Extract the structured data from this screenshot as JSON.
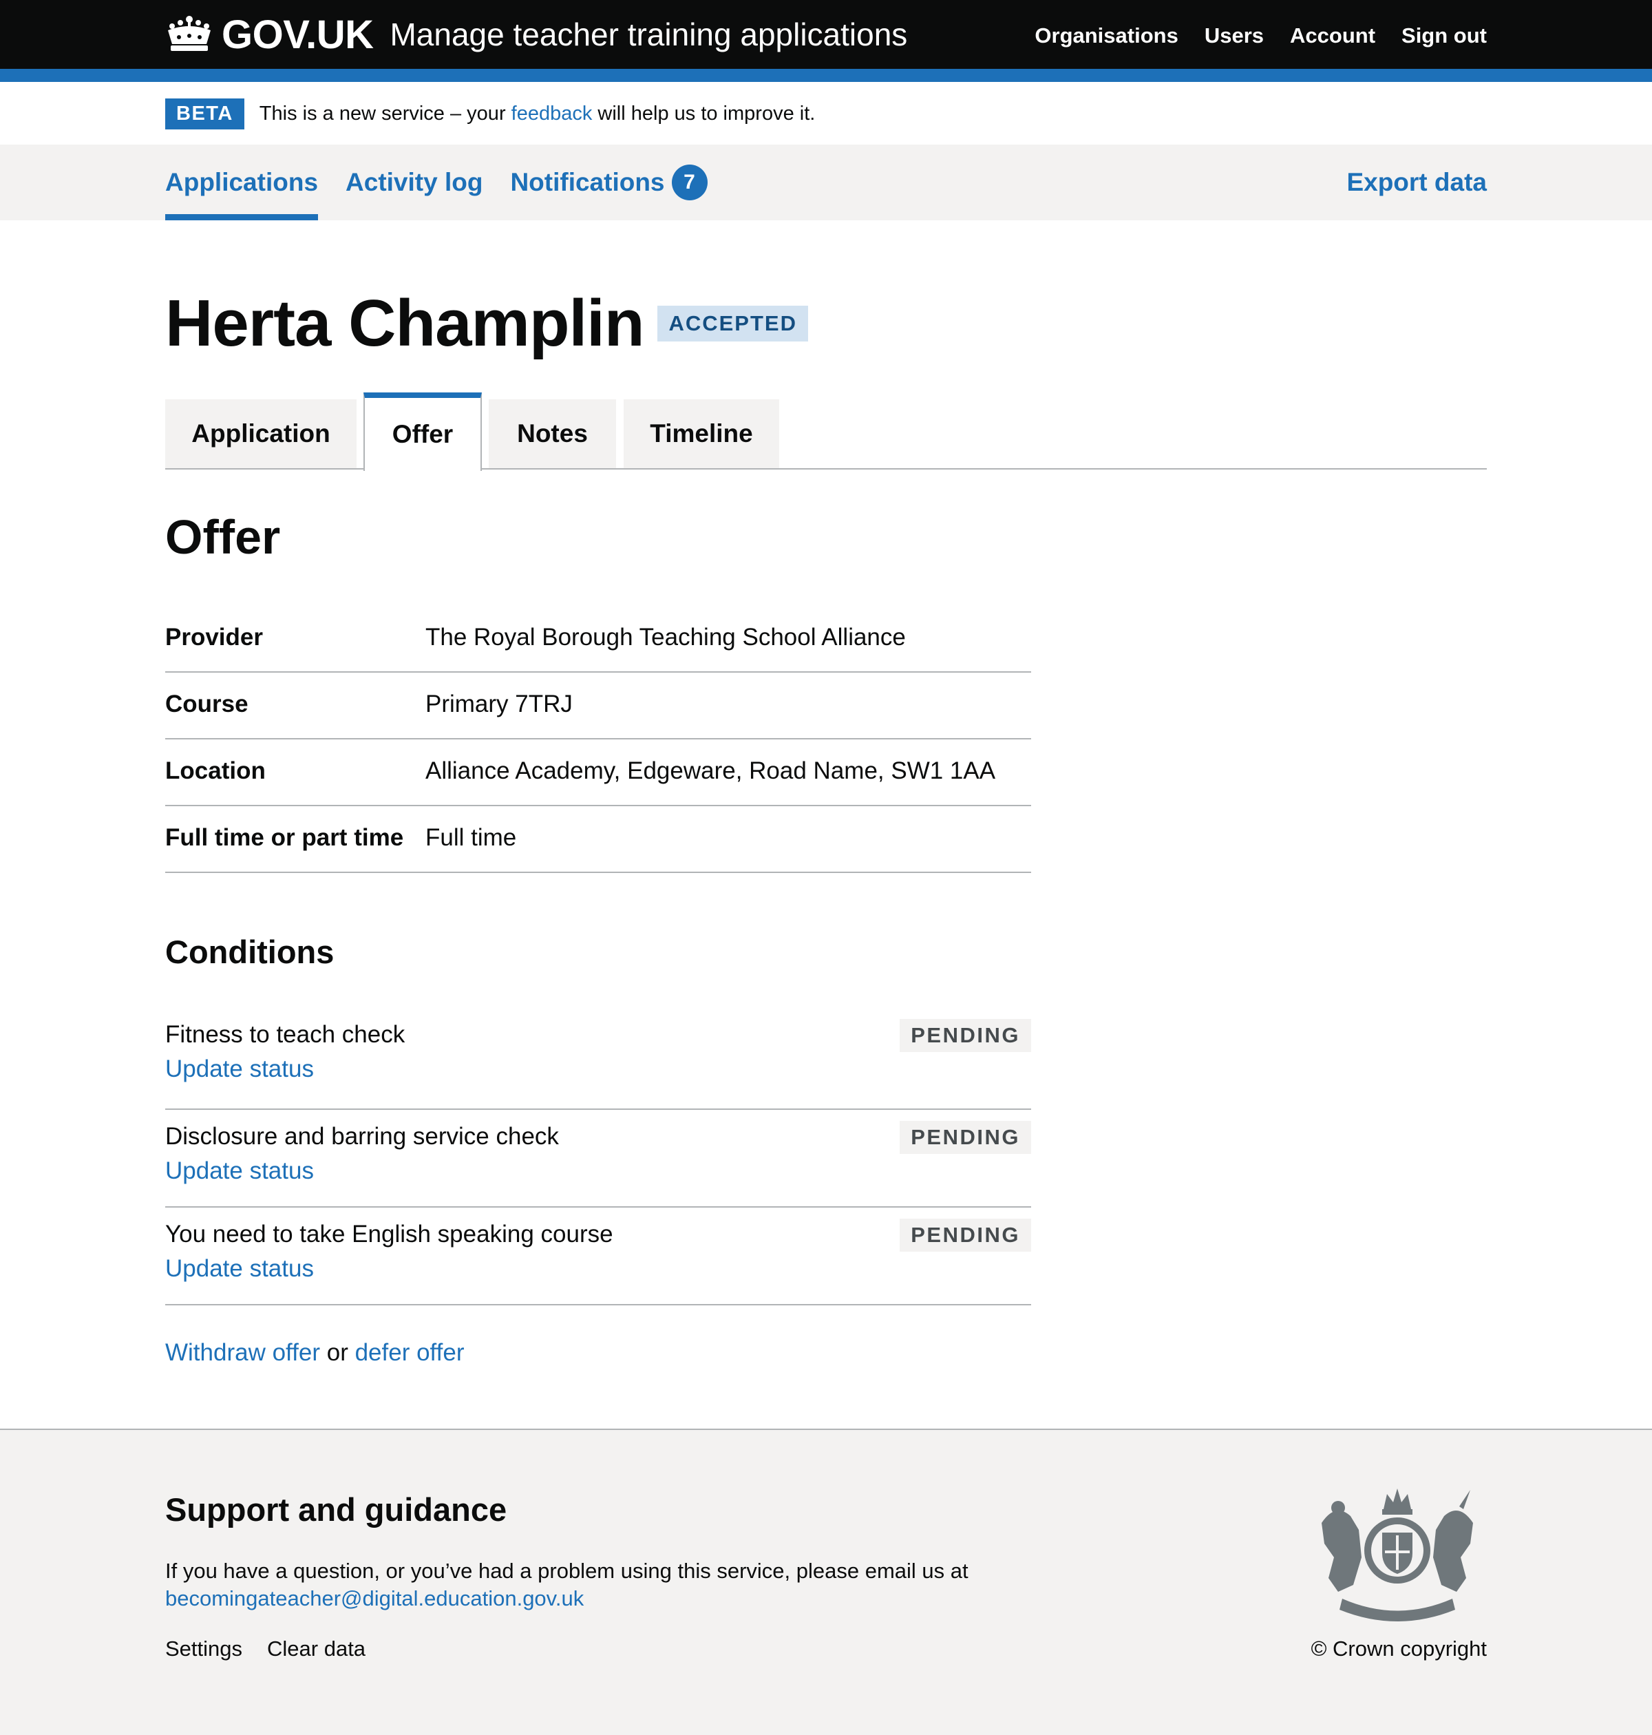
{
  "header": {
    "logo_icon": "crown-icon",
    "brand": "GOV.UK",
    "service_name": "Manage teacher training applications",
    "nav": [
      {
        "label": "Organisations"
      },
      {
        "label": "Users"
      },
      {
        "label": "Account"
      },
      {
        "label": "Sign out"
      }
    ],
    "stripe_color": "#1d70b8"
  },
  "beta_banner": {
    "tag": "BETA",
    "text_before": "This is a new service – your ",
    "link": "feedback",
    "text_after": " will help us to improve it."
  },
  "primary_nav": {
    "items": [
      {
        "label": "Applications",
        "active": true
      },
      {
        "label": "Activity log"
      },
      {
        "label": "Notifications",
        "count": "7"
      }
    ],
    "export": "Export data"
  },
  "candidate": {
    "name": "Herta Champlin",
    "status": "ACCEPTED"
  },
  "tabs": [
    {
      "label": "Application"
    },
    {
      "label": "Offer",
      "selected": true
    },
    {
      "label": "Notes"
    },
    {
      "label": "Timeline"
    }
  ],
  "offer": {
    "title": "Offer",
    "rows": [
      {
        "key": "Provider",
        "value": "The Royal Borough Teaching School Alliance"
      },
      {
        "key": "Course",
        "value": "Primary 7TRJ"
      },
      {
        "key": "Location",
        "value": "Alliance Academy, Edgeware, Road Name, SW1 1AA"
      },
      {
        "key": "Full time or part time",
        "value": "Full time"
      }
    ],
    "conditions_title": "Conditions",
    "conditions": [
      {
        "text": "Fitness to teach check",
        "status": "PENDING",
        "link": "Update status"
      },
      {
        "text": "Disclosure and barring service check",
        "status": "PENDING",
        "link": "Update status"
      },
      {
        "text": "You need to take English speaking course",
        "status": "PENDING",
        "link": "Update status"
      }
    ],
    "withdraw": "Withdraw offer",
    "or": " or ",
    "defer": "defer offer"
  },
  "footer": {
    "title": "Support and guidance",
    "text": "If you have a question, or you’ve had a problem using this service, please email us at",
    "email": "becomingateacher@digital.education.gov.uk",
    "links": [
      {
        "label": "Settings"
      },
      {
        "label": "Clear data"
      }
    ],
    "crest_icon": "royal-coat-of-arms-icon",
    "copyright": "© Crown copyright"
  }
}
